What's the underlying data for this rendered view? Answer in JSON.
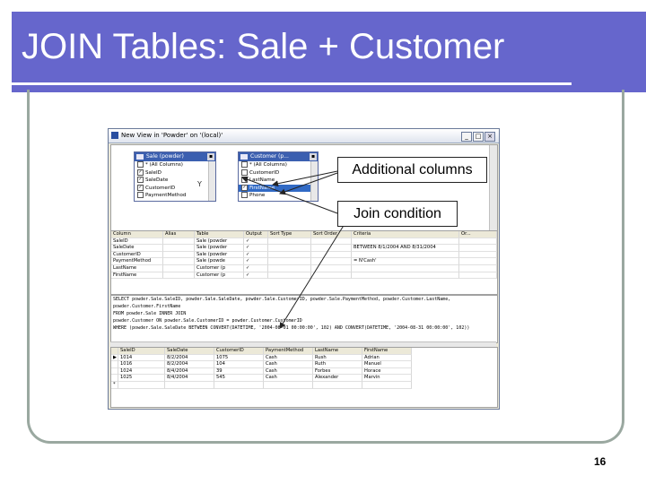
{
  "slide": {
    "title": "JOIN Tables: Sale + Customer",
    "page_number": "16",
    "theme_color": "#6666cc"
  },
  "window": {
    "title": "New View in 'Powder' on '(local)'",
    "min_glyph": "_",
    "max_glyph": "□",
    "close_glyph": "×"
  },
  "diagram": {
    "sale_table": {
      "header": "Sale (powder)",
      "rows": [
        {
          "label": "* (All Columns)",
          "checked": false
        },
        {
          "label": "SaleID",
          "checked": true
        },
        {
          "label": "SaleDate",
          "checked": true
        },
        {
          "label": "CustomerID",
          "checked": true
        },
        {
          "label": "PaymentMethod",
          "checked": false
        }
      ]
    },
    "customer_table": {
      "header": "Customer (p...",
      "rows": [
        {
          "label": "* (All Columns)",
          "checked": false
        },
        {
          "label": "CustomerID",
          "checked": false
        },
        {
          "label": "LastName",
          "checked": true
        },
        {
          "label": "FirstName",
          "checked": true
        },
        {
          "label": "Phone",
          "checked": false
        }
      ]
    },
    "join_glyph": "Y"
  },
  "criteria_grid": {
    "headers": [
      "Column",
      "Alias",
      "Table",
      "Output",
      "Sort Type",
      "Sort Order",
      "Criteria",
      "Or..."
    ],
    "rows": [
      [
        "SaleID",
        "",
        "Sale (powder",
        "✓",
        "",
        "",
        "",
        ""
      ],
      [
        "SaleDate",
        "",
        "Sale (powder",
        "✓",
        "",
        "",
        "BETWEEN 8/1/2004 AND 8/31/2004",
        ""
      ],
      [
        "CustomerID",
        "",
        "Sale (powder",
        "✓",
        "",
        "",
        "",
        ""
      ],
      [
        "PaymentMethod",
        "",
        "Sale (powde",
        "✓",
        "",
        "",
        "= N'Cash'",
        ""
      ],
      [
        "LastName",
        "",
        "Customer (p",
        "✓",
        "",
        "",
        "",
        ""
      ],
      [
        "FirstName",
        "",
        "Customer (p",
        "✓",
        "",
        "",
        "",
        ""
      ]
    ]
  },
  "sql": {
    "lines": [
      "SELECT   powder.Sale.SaleID, powder.Sale.SaleDate, powder.Sale.CustomerID, powder.Sale.PaymentMethod, powder.Customer.LastName,",
      "         powder.Customer.FirstName",
      "FROM     powder.Sale INNER JOIN",
      "         powder.Customer ON powder.Sale.CustomerID = powder.Customer.CustomerID",
      "WHERE    (powder.Sale.SaleDate BETWEEN CONVERT(DATETIME, '2004-08-01 00:00:00', 102) AND CONVERT(DATETIME, '2004-08-31 00:00:00', 102))"
    ]
  },
  "results": {
    "headers": [
      "SaleID",
      "SaleDate",
      "CustomerID",
      "PaymentMethod",
      "LastName",
      "FirstName"
    ],
    "rows": [
      [
        "1014",
        "8/2/2004",
        "1075",
        "Cash",
        "Rush",
        "Adrian"
      ],
      [
        "1016",
        "8/2/2004",
        "104",
        "Cash",
        "Ruth",
        "Manuel"
      ],
      [
        "1024",
        "8/4/2004",
        "39",
        "Cash",
        "Forbes",
        "Horace"
      ],
      [
        "1025",
        "8/4/2004",
        "545",
        "Cash",
        "Alexander",
        "Marvin"
      ]
    ],
    "new_row_marker": "*",
    "current_row_marker": "▶"
  },
  "callouts": {
    "additional_columns": "Additional columns",
    "join_condition": "Join condition"
  }
}
